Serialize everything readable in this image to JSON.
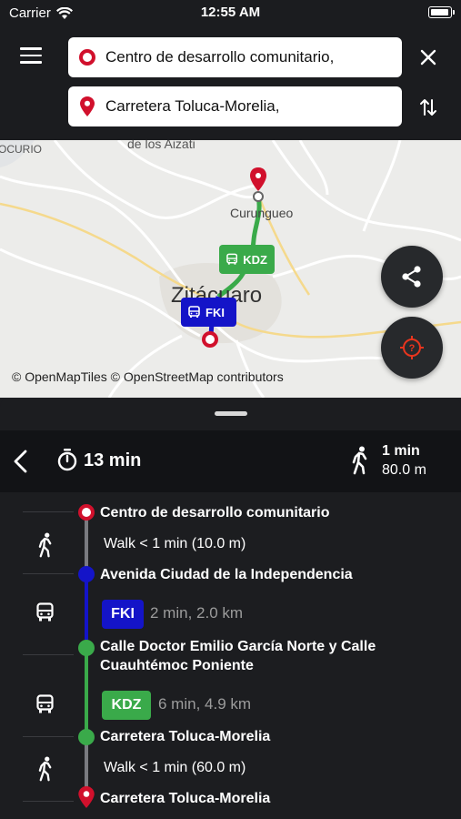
{
  "status_bar": {
    "carrier": "Carrier",
    "time": "12:55 AM"
  },
  "search": {
    "from_value": "Centro de desarrollo comunitario,",
    "to_value": "Carretera Toluca-Morelia,"
  },
  "map": {
    "labels": {
      "ocurio": "OCURIO",
      "aizati": "de los Aizati",
      "curungueo": "Curungueo",
      "zitacuaro": "Zitácuaro"
    },
    "attribution": "© OpenMapTiles © OpenStreetMap contributors",
    "route_tags": [
      {
        "code": "KDZ",
        "color": "#3aaa4a"
      },
      {
        "code": "FKI",
        "color": "#1414c8"
      }
    ]
  },
  "summary": {
    "duration": "13 min",
    "walk_time": "1 min",
    "walk_distance": "80.0 m"
  },
  "itinerary": {
    "stops": [
      "Centro de desarrollo comunitario",
      "Avenida Ciudad de la Independencia",
      "Calle Doctor Emilio García Norte y Calle",
      "Cuauhtémoc Poniente",
      "Carretera Toluca-Morelia",
      "Carretera Toluca-Morelia"
    ],
    "legs": [
      {
        "mode": "walk",
        "text": "Walk < 1 min (10.0 m)"
      },
      {
        "mode": "bus",
        "route": "FKI",
        "route_color": "#1414c8",
        "text": "2 min, 2.0 km"
      },
      {
        "mode": "bus",
        "route": "KDZ",
        "route_color": "#3aaa4a",
        "text": "6 min, 4.9 km"
      },
      {
        "mode": "walk",
        "text": "Walk < 1 min (60.0 m)"
      }
    ]
  },
  "colors": {
    "origin_red": "#d1102c",
    "fki_blue": "#1414c8",
    "kdz_green": "#3aaa4a",
    "walk_gray": "#8a8a8a"
  }
}
